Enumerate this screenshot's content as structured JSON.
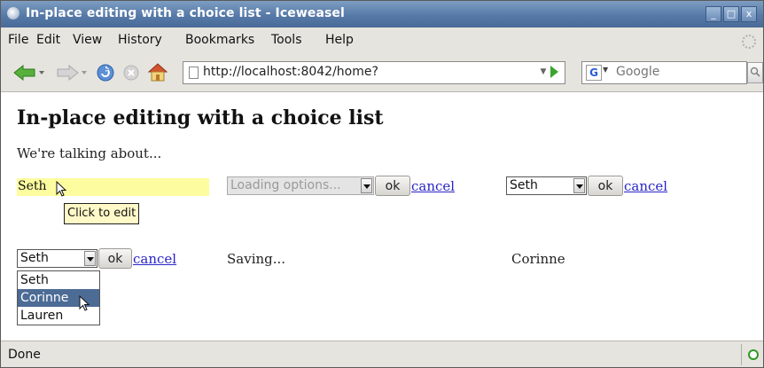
{
  "window": {
    "title": "In-place editing with a choice list - Iceweasel",
    "controls": {
      "minimize": "_",
      "maximize": "□",
      "close": "x"
    }
  },
  "menu": [
    "File",
    "Edit",
    "View",
    "History",
    "Bookmarks",
    "Tools",
    "Help"
  ],
  "toolbar": {
    "url": "http://localhost:8042/home?",
    "search_engine_letter": "G",
    "search_placeholder": "Google"
  },
  "page": {
    "title": "In-place editing with a choice list",
    "intro": "We're talking about...",
    "row1": {
      "editable_value": "Seth",
      "tooltip": "Click to edit",
      "loading_select": "Loading options...",
      "ok": "ok",
      "cancel": "cancel",
      "select_value": "Seth"
    },
    "row2": {
      "select_value": "Seth",
      "ok": "ok",
      "cancel": "cancel",
      "options": [
        "Seth",
        "Corinne",
        "Lauren"
      ],
      "highlighted_option": "Corinne",
      "saving_text": "Saving...",
      "saved_value": "Corinne"
    }
  },
  "status": {
    "text": "Done"
  }
}
